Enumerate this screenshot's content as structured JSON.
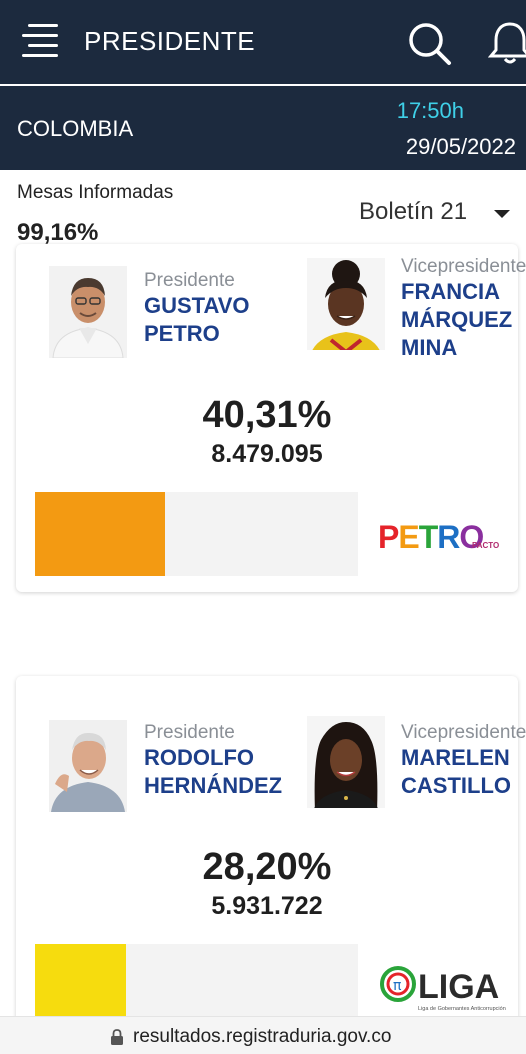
{
  "header": {
    "title": "PRESIDENTE"
  },
  "info": {
    "country": "COLOMBIA",
    "time": "17:50h",
    "date": "29/05/2022"
  },
  "summary": {
    "mesas_label": "Mesas Informadas",
    "mesas_value": "99,16%",
    "boletin": "Boletín 21"
  },
  "candidates": [
    {
      "president_role": "Presidente",
      "president_name": "GUSTAVO\nPETRO",
      "vice_role": "Vicepresidente",
      "vice_name": "FRANCIA\nMÁRQUEZ\nMINA",
      "percent": "40,31%",
      "votes": "8.479.095",
      "share": 0.4031,
      "bar_color": "#f39a12",
      "logo_text": "PETRO",
      "logo_badge": "PACTO"
    },
    {
      "president_role": "Presidente",
      "president_name": "RODOLFO\nHERNÁNDEZ",
      "vice_role": "Vicepresidente",
      "vice_name": "MARELEN\nCASTILLO",
      "percent": "28,20%",
      "votes": "5.931.722",
      "share": 0.282,
      "bar_color": "#f6dc0e",
      "logo_text": "LIGA",
      "logo_subtitle": "Liga de Gobernantes Anticorrupción"
    }
  ],
  "browser": {
    "url": "resultados.registraduria.gov.co"
  },
  "colors": {
    "navy": "#1c2a3e",
    "accent_cyan": "#3fd0e8",
    "name_blue": "#1d3f8a"
  }
}
